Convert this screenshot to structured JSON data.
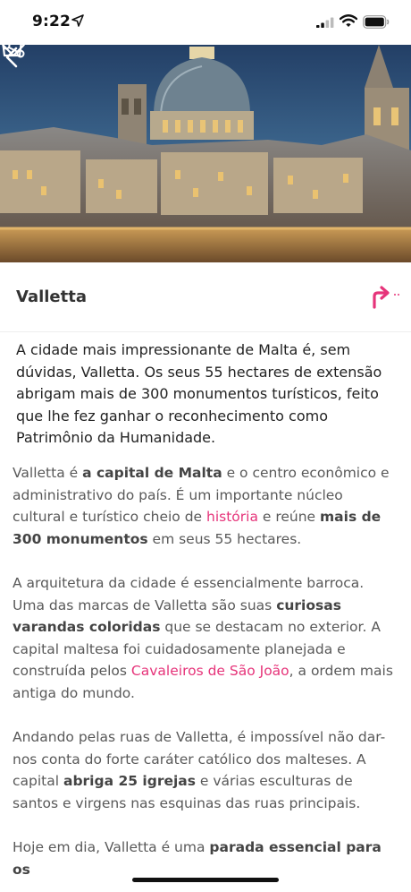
{
  "status": {
    "time": "9:22"
  },
  "icons": {
    "location": "location-arrow-icon",
    "signal": "signal-icon",
    "wifi": "wifi-icon",
    "battery": "battery-icon",
    "back": "chevron-left-icon",
    "favorite": "heart-icon",
    "share": "share-icon",
    "cart": "cart-icon",
    "directions": "directions-arrow-icon"
  },
  "colors": {
    "accent": "#e6347a",
    "title": "#333333",
    "body_text": "#595959"
  },
  "place": {
    "title": "Valletta"
  },
  "content": {
    "intro": "A cidade mais impressionante de Malta é, sem dúvidas, Valletta. Os seus 55 hectares de extensão abrigam mais de 300 monumentos turísticos, feito que lhe fez ganhar o reconhecimento como Patrimônio da Humanidade.",
    "p1": {
      "t1": "Valletta é ",
      "b1": "a capital de Malta",
      "t2": " e o centro econômico e administrativo do país. É um importante núcleo cultural e turístico cheio de ",
      "link1": "história",
      "t3": " e reúne ",
      "b2": "mais de 300 monumentos",
      "t4": " em seus 55 hectares."
    },
    "p2": {
      "t1": "A arquitetura da cidade é essencialmente barroca. Uma das marcas de Valletta são suas ",
      "b1": "curiosas varandas coloridas",
      "t2": " que se destacam no exterior. A capital maltesa foi cuidadosamente planejada e construída pelos ",
      "link1": "Cavaleiros de São João",
      "t3": ", a ordem mais antiga do mundo."
    },
    "p3": {
      "t1": "Andando pelas ruas de Valletta, é impossível não dar-nos conta do forte caráter católico dos malteses. A capital ",
      "b1": "abriga 25 igrejas",
      "t2": " e várias esculturas de santos e virgens nas esquinas das ruas principais."
    },
    "p4": {
      "t1": "Hoje em dia, Valletta é uma ",
      "b1": "parada essencial para os"
    }
  }
}
